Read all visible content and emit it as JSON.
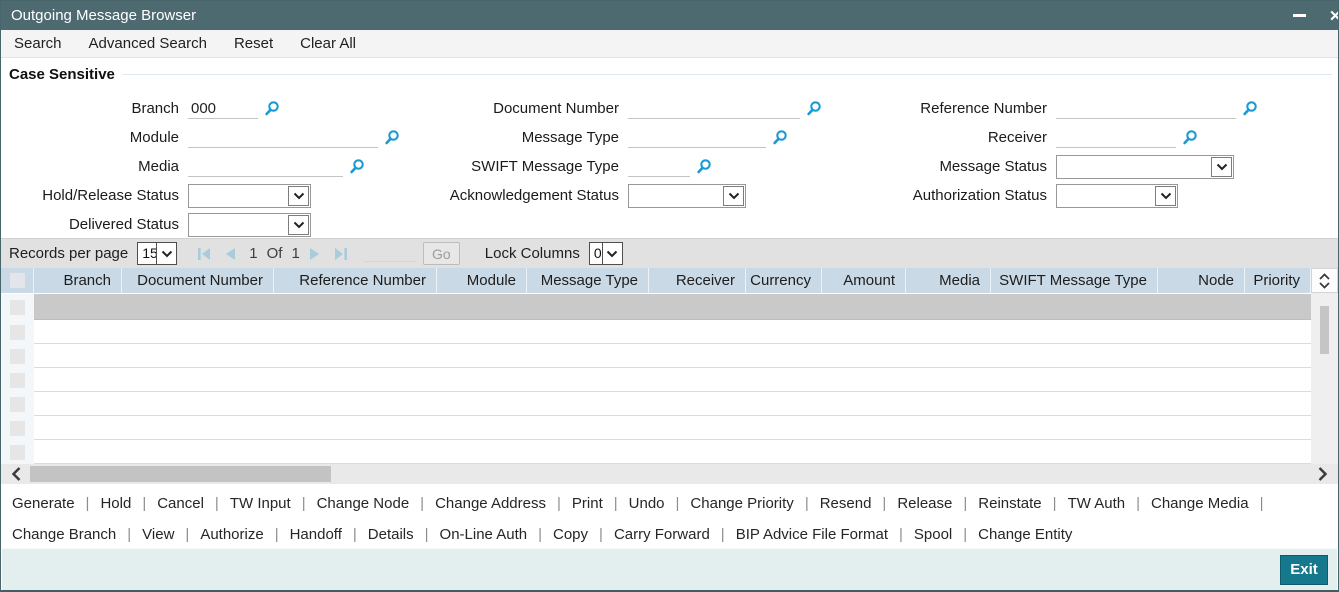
{
  "window": {
    "title": "Outgoing Message Browser",
    "minimize_icon": "minus-bar",
    "close_icon": "x"
  },
  "toolbar": {
    "items": [
      "Search",
      "Advanced Search",
      "Reset",
      "Clear All"
    ]
  },
  "form": {
    "legend": "Case Sensitive",
    "fields": {
      "branch": {
        "label": "Branch",
        "value": "000"
      },
      "module": {
        "label": "Module",
        "value": ""
      },
      "media": {
        "label": "Media",
        "value": ""
      },
      "hold_release_status": {
        "label": "Hold/Release Status",
        "value": ""
      },
      "delivered_status": {
        "label": "Delivered Status",
        "value": ""
      },
      "document_number": {
        "label": "Document Number",
        "value": ""
      },
      "message_type": {
        "label": "Message Type",
        "value": ""
      },
      "swift_message_type": {
        "label": "SWIFT Message Type",
        "value": ""
      },
      "acknowledgement_status": {
        "label": "Acknowledgement Status",
        "value": ""
      },
      "reference_number": {
        "label": "Reference Number",
        "value": ""
      },
      "receiver": {
        "label": "Receiver",
        "value": ""
      },
      "message_status": {
        "label": "Message Status",
        "value": ""
      },
      "authorization_status": {
        "label": "Authorization Status",
        "value": ""
      }
    }
  },
  "pagination": {
    "records_per_page_label": "Records per page",
    "records_per_page_value": "15",
    "current_page": "1",
    "of_label": "Of",
    "total_pages": "1",
    "page_input_value": "",
    "go_label": "Go",
    "lock_columns_label": "Lock Columns",
    "lock_columns_value": "0"
  },
  "table": {
    "columns": [
      "Branch",
      "Document Number",
      "Reference Number",
      "Module",
      "Message Type",
      "Receiver",
      "Currency",
      "Amount",
      "Media",
      "SWIFT Message Type",
      "Node",
      "Priority"
    ],
    "rows": [],
    "visible_empty_rows": 7
  },
  "actions": {
    "separator": "|",
    "row1": [
      "Generate",
      "Hold",
      "Cancel",
      "TW Input",
      "Change Node",
      "Change Address",
      "Print",
      "Undo",
      "Change Priority",
      "Resend",
      "Release",
      "Reinstate",
      "TW Auth",
      "Change Media"
    ],
    "row2": [
      "Change Branch",
      "View",
      "Authorize",
      "Handoff",
      "Details",
      "On-Line Auth",
      "Copy",
      "Carry Forward",
      "BIP Advice File Format",
      "Spool",
      "Change Entity"
    ]
  },
  "footer": {
    "exit_label": "Exit"
  },
  "colors": {
    "titlebar": "#4d6a70",
    "accent_blue": "#1b9ad2",
    "table_header_bg": "#c9d9e6",
    "selected_row": "#c9c9c9",
    "pagination_icon": "#a9ccdd",
    "exit_button": "#16788c"
  }
}
